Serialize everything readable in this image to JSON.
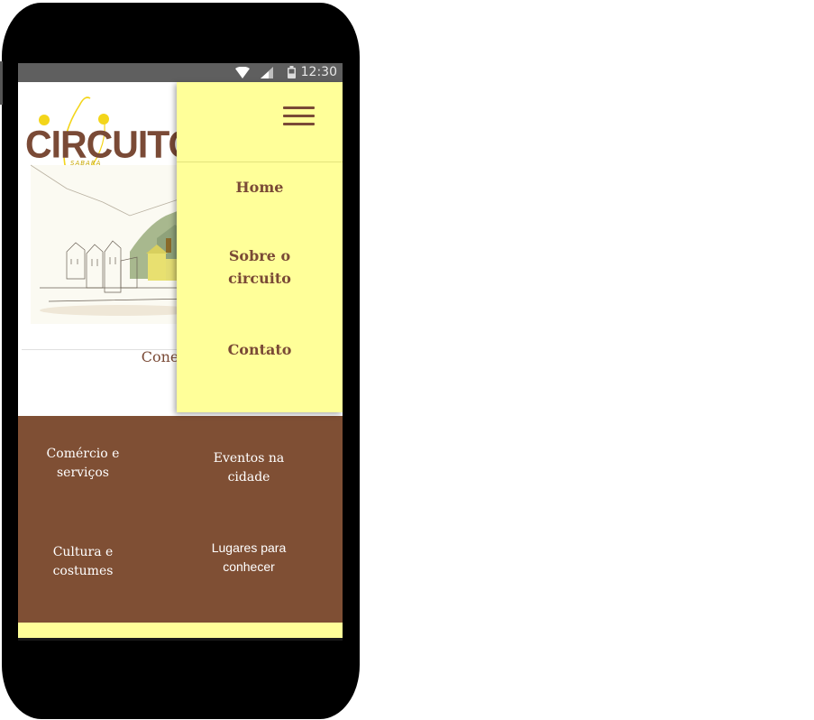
{
  "status_bar": {
    "time": "12:30"
  },
  "logo": {
    "title": "CIRCUITO",
    "subtitle": "SABARÁ"
  },
  "drawer": {
    "menu": [
      "Home",
      "Sobre o circuito",
      "Contato"
    ]
  },
  "tagline": "Conecta",
  "tiles": [
    {
      "label_line1": "Comércio e",
      "label_line2": "serviços"
    },
    {
      "label_line1": "Eventos na",
      "label_line2": "cidade"
    },
    {
      "label_line1": "Cultura e",
      "label_line2": "costumes"
    },
    {
      "label_line1": "Lugares para",
      "label_line2": "conhecer"
    }
  ],
  "colors": {
    "brand_brown": "#7a4a36",
    "tile_brown": "#7f4f34",
    "drawer_yellow": "#ffff99",
    "logo_yellow": "#f3d51a"
  },
  "icons": [
    "wifi-icon",
    "signal-icon",
    "battery-icon",
    "hamburger-menu-icon"
  ]
}
